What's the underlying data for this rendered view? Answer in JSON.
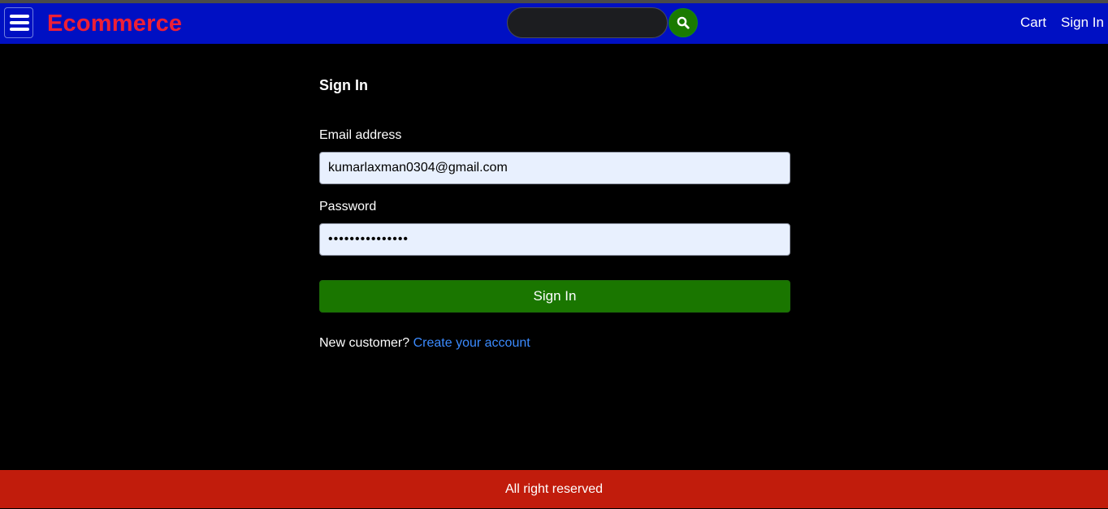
{
  "navbar": {
    "brand": "Ecommerce",
    "search": {
      "value": "",
      "placeholder": ""
    },
    "links": {
      "cart": "Cart",
      "sign_in": "Sign In"
    }
  },
  "form": {
    "title": "Sign In",
    "email_label": "Email address",
    "email_value": "kumarlaxman0304@gmail.com",
    "password_label": "Password",
    "password_value": "•••••••••••••••",
    "submit_label": "Sign In",
    "signup_prompt": "New customer?",
    "signup_link": "Create your account"
  },
  "footer": {
    "text": "All right reserved"
  },
  "colors": {
    "navbar_bg": "#0010c3",
    "brand": "#ee1f36",
    "search_button": "#1a7a00",
    "submit_button": "#1a7600",
    "link": "#3b8bff",
    "footer_bg": "#c11c0c",
    "page_bg": "#000000"
  },
  "icons": {
    "menu": "hamburger-menu-icon",
    "search": "search-icon"
  }
}
